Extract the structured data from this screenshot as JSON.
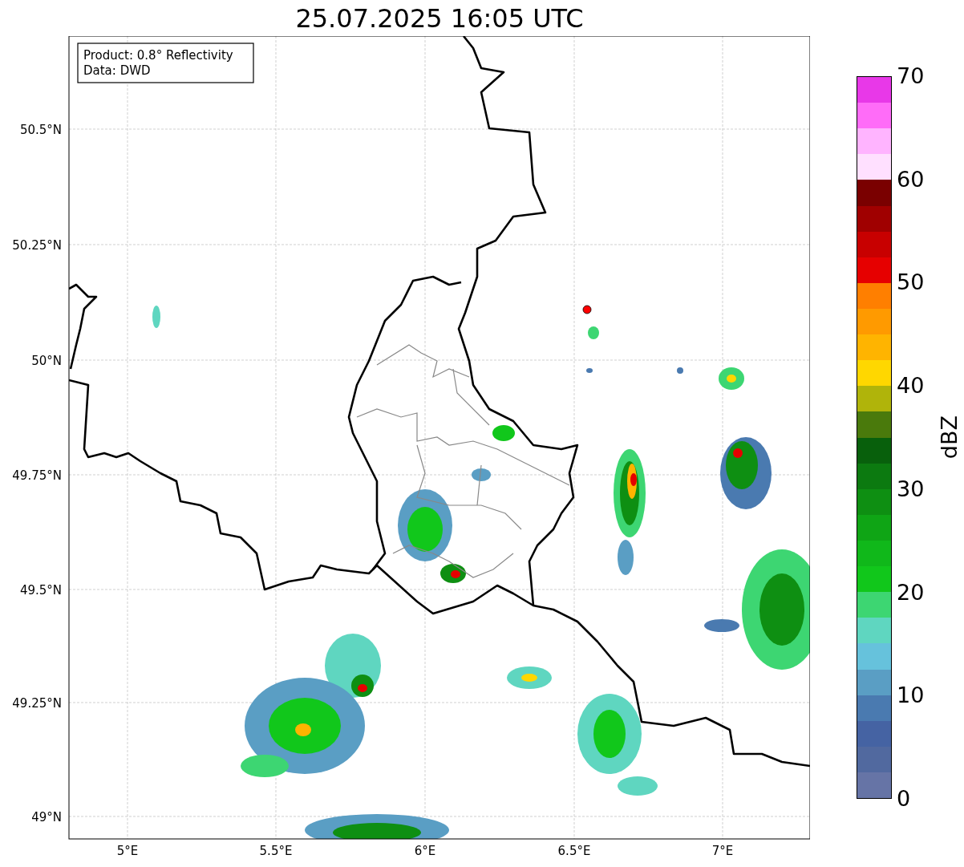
{
  "title": "25.07.2025 16:05 UTC",
  "info_box": [
    "Product: 0.8° Reflectivity",
    "Data: DWD"
  ],
  "lat_labels": [
    "50.5°N",
    "50.25°N",
    "50°N",
    "49.75°N",
    "49.5°N",
    "49.25°N",
    "49°N"
  ],
  "lon_labels": [
    "5°E",
    "5.5°E",
    "6°E",
    "6.5°E",
    "7°E"
  ],
  "colorbar": {
    "label": "dBZ",
    "ticks": [
      "70",
      "60",
      "50",
      "40",
      "30",
      "20",
      "10",
      "0"
    ],
    "bins": [
      {
        "color": "#e838e8"
      },
      {
        "color": "#ff6cf8"
      },
      {
        "color": "#ffb4ff"
      },
      {
        "color": "#ffe0ff"
      },
      {
        "color": "#7a0000"
      },
      {
        "color": "#a00000"
      },
      {
        "color": "#c80000"
      },
      {
        "color": "#e60000"
      },
      {
        "color": "#ff7f00"
      },
      {
        "color": "#ff9a00"
      },
      {
        "color": "#ffb400"
      },
      {
        "color": "#ffd700"
      },
      {
        "color": "#b0b40a"
      },
      {
        "color": "#4a7a0c"
      },
      {
        "color": "#08600c"
      },
      {
        "color": "#0c7a10"
      },
      {
        "color": "#0e8f12"
      },
      {
        "color": "#0fa515"
      },
      {
        "color": "#10b81a"
      },
      {
        "color": "#11c71b"
      },
      {
        "color": "#3dd672"
      },
      {
        "color": "#5fd6c0"
      },
      {
        "color": "#66c2dc"
      },
      {
        "color": "#5a9ec4"
      },
      {
        "color": "#4a7ab0"
      },
      {
        "color": "#4563a3"
      },
      {
        "color": "#51699f"
      },
      {
        "color": "#6674a6"
      }
    ]
  }
}
